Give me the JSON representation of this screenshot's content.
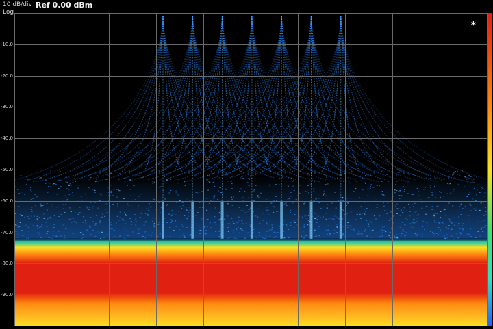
{
  "header": {
    "scale_label": "10 dB/div",
    "scale_mode": "Log",
    "ref_label": "Ref 0.00 dBm"
  },
  "marker_symbol": "*",
  "y_axis": {
    "tick_labels": [
      "-10.0",
      "-20.0",
      "-30.0",
      "-40.0",
      "-50.0",
      "-60.0",
      "-70.0",
      "-80.0",
      "-90.0"
    ]
  },
  "colors": {
    "background": "#000000",
    "grid": "#6a6a6a",
    "trace": "#2a8cff",
    "trace_bright": "#7fd0ff",
    "density_hot": "#e02010",
    "density_warm": "#ff8a10",
    "density_mid": "#f8e020",
    "density_cool": "#30e0c0"
  },
  "chart_data": {
    "type": "heatmap",
    "title": "",
    "ylim": [
      -100,
      0
    ],
    "grid": true,
    "carrier_count": 7,
    "carrier_peak_dbm": -1,
    "trace_floor_dbm": -50,
    "noise_band_dbm": [
      -72,
      -100
    ]
  }
}
